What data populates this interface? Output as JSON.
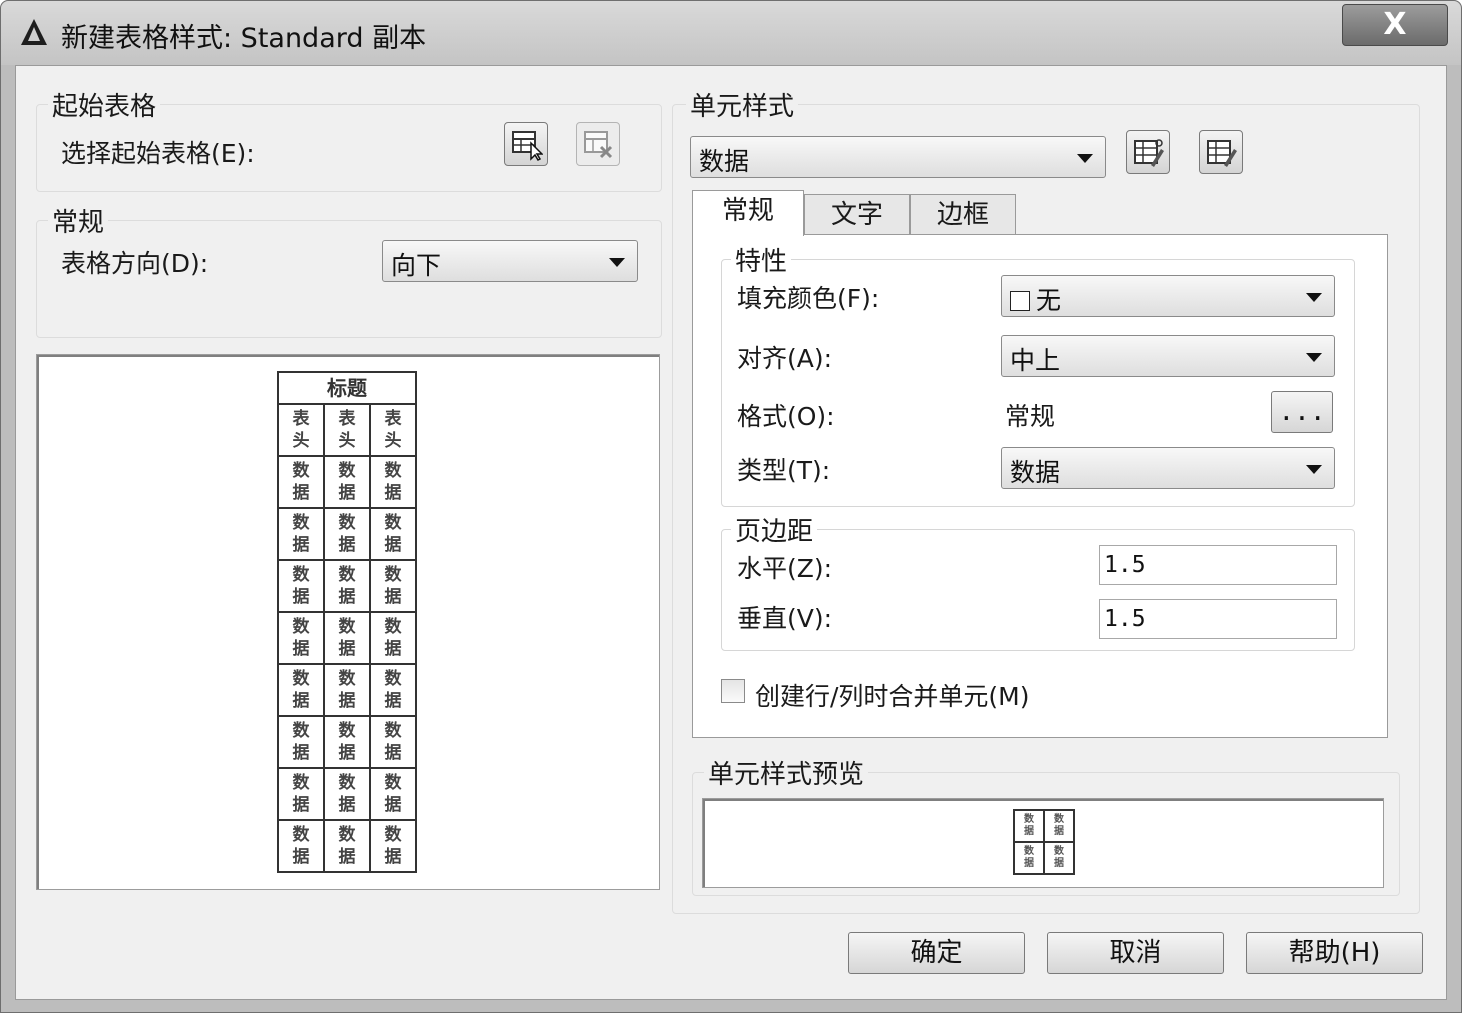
{
  "window": {
    "title": "新建表格样式: Standard 副本",
    "close_label": "X"
  },
  "start_table": {
    "group_title": "起始表格",
    "select_label": "选择起始表格(E):"
  },
  "general": {
    "group_title": "常规",
    "direction_label": "表格方向(D):",
    "direction_value": "向下"
  },
  "preview_table": {
    "title": "标题",
    "header_cells": [
      "表\n头",
      "表\n头",
      "表\n头"
    ],
    "data_cell": "数\n据",
    "data_rows": 8
  },
  "cell_style": {
    "group_title": "单元样式",
    "selected": "数据",
    "tabs": [
      "常规",
      "文字",
      "边框"
    ],
    "active_tab": "常规",
    "properties": {
      "group_title": "特性",
      "fill_label": "填充颜色(F):",
      "fill_value": "无",
      "align_label": "对齐(A):",
      "align_value": "中上",
      "format_label": "格式(O):",
      "format_value": "常规",
      "format_button": "...",
      "type_label": "类型(T):",
      "type_value": "数据"
    },
    "margins": {
      "group_title": "页边距",
      "horizontal_label": "水平(Z):",
      "horizontal_value": "1.5",
      "vertical_label": "垂直(V):",
      "vertical_value": "1.5"
    },
    "merge_label": "创建行/列时合并单元(M)",
    "merge_checked": false,
    "preview_title": "单元样式预览",
    "preview_cell": "数\n据"
  },
  "buttons": {
    "ok": "确定",
    "cancel": "取消",
    "help": "帮助(H)"
  }
}
